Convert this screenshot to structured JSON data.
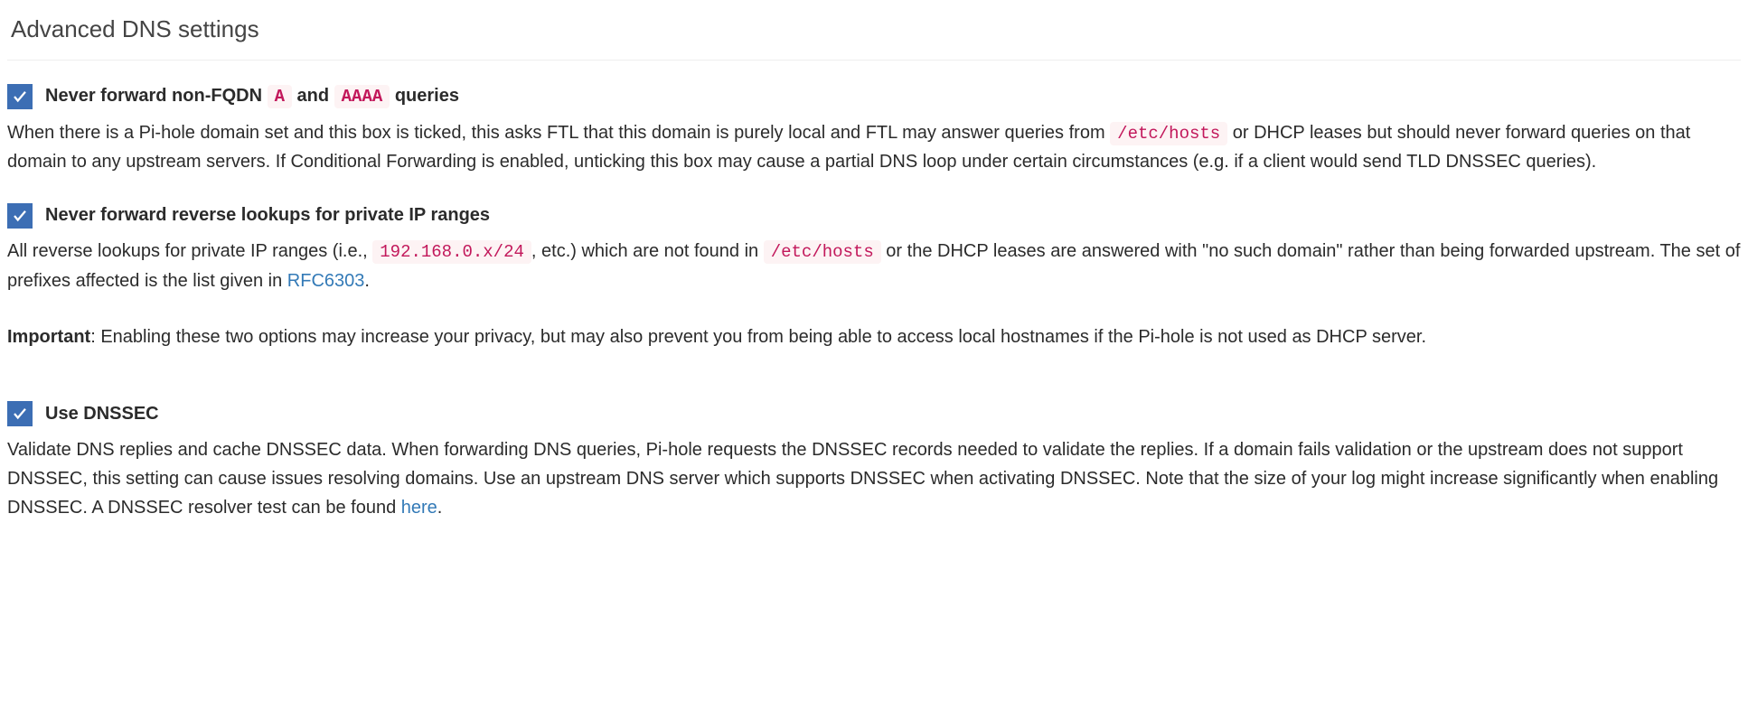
{
  "panel": {
    "title": "Advanced DNS settings"
  },
  "settings": {
    "nonfqdn": {
      "checked": true,
      "label_pre": "Never forward non-FQDN ",
      "code1": "A",
      "label_mid": " and ",
      "code2": "AAAA",
      "label_post": " queries",
      "desc_pre": "When there is a Pi-hole domain set and this box is ticked, this asks FTL that this domain is purely local and FTL may answer queries from ",
      "desc_code1": "/etc/hosts",
      "desc_post": " or DHCP leases but should never forward queries on that domain to any upstream servers. If Conditional Forwarding is enabled, unticking this box may cause a partial DNS loop under certain circumstances (e.g. if a client would send TLD DNSSEC queries)."
    },
    "reverse": {
      "checked": true,
      "label": "Never forward reverse lookups for private IP ranges",
      "desc_pre": "All reverse lookups for private IP ranges (i.e., ",
      "desc_code1": "192.168.0.x/24",
      "desc_mid1": ", etc.) which are not found in ",
      "desc_code2": "/etc/hosts",
      "desc_mid2": " or the DHCP leases are answered with \"no such domain\" rather than being forwarded upstream. The set of prefixes affected is the list given in ",
      "desc_link": "RFC6303",
      "desc_post": "."
    },
    "important": {
      "strong": "Important",
      "text": ": Enabling these two options may increase your privacy, but may also prevent you from being able to access local hostnames if the Pi-hole is not used as DHCP server."
    },
    "dnssec": {
      "checked": true,
      "label": "Use DNSSEC",
      "desc_pre": "Validate DNS replies and cache DNSSEC data. When forwarding DNS queries, Pi-hole requests the DNSSEC records needed to validate the replies. If a domain fails validation or the upstream does not support DNSSEC, this setting can cause issues resolving domains. Use an upstream DNS server which supports DNSSEC when activating DNSSEC. Note that the size of your log might increase significantly when enabling DNSSEC. A DNSSEC resolver test can be found ",
      "desc_link": "here",
      "desc_post": "."
    }
  }
}
